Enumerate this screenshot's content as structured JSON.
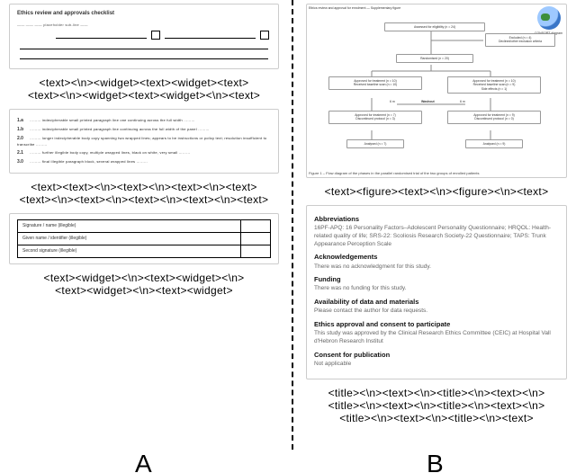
{
  "labels": {
    "colA": "A",
    "colB": "B"
  },
  "a1": {
    "title_line": "Ethics review and approvals checklist",
    "subtitle": "——  ——  ——  placeholder sub-line  ——",
    "field1": "",
    "field2": ""
  },
  "caption_a1": "<text><\\n><widget><text><widget><text>\n<text><\\n><widget><text><widget><\\n><text>",
  "a2": {
    "items": [
      {
        "n": "1.a",
        "t": "……… indecipherable small printed paragraph line one continuing across the full width ………"
      },
      {
        "n": "1.b",
        "t": "……… indecipherable small printed paragraph line continuing across the full width of the panel ………"
      },
      {
        "n": "2.0",
        "t": "……… longer indecipherable body copy spanning two wrapped lines; appears to be instructions or policy text; resolution insufficient to transcribe ………"
      },
      {
        "n": "2.1",
        "t": "……… further illegible body copy, multiple wrapped lines, black on white, very small ………"
      },
      {
        "n": "3.0",
        "t": "……… final illegible paragraph block, several wrapped lines ………"
      }
    ]
  },
  "caption_a2": "<text><text><\\n><text><\\n><text><\\n><text>\n<text><\\n><text><\\n><text><\\n><text><\\n><text>",
  "a3": {
    "rows": [
      [
        "Signature / name (illegible)",
        ""
      ],
      [
        "Given name / identifier (illegible)",
        ""
      ],
      [
        "Second signature (illegible)",
        ""
      ]
    ]
  },
  "caption_a3": "<text><widget><\\n><text><widget><\\n>\n<text><widget><\\n><text><widget>",
  "b1": {
    "corner_left": "Ethics review and approval for enrolment — Supplementary figure",
    "corner_right": "CONSORT diagram",
    "assessed": "Assessed for eligibility (n = 24)",
    "excluded_head": "Excluded (n = 4)",
    "excluded_sub": "Declined/other exclusion criteria",
    "randomised": "Randomised (n = 20)",
    "armL_head": "Approved for treatment (n = 10)",
    "armL_sub": "Received baseline scan (n = 10)",
    "armR_head": "Approved for treatment (n = 10)",
    "armR_sub1": "Received baseline scan (n = 9)",
    "armR_sub2": "Side effects (n = 1)",
    "washout_label": "Washout",
    "t_left": "6 m",
    "t_right": "6 m",
    "armL2_head": "Approved for treatment (n = 7)",
    "armL2_sub": "Discontinued protocol (n = 3)",
    "armR2_head": "Approved for treatment (n = 9)",
    "armR2_sub": "Discontinued protocol (n = 0)",
    "anaL": "Analysed (n = 7)",
    "anaR": "Analysed (n = 9)",
    "figcap": "Figure 1 – Flow diagram of the phases in the parallel randomised trial of the two groups of enrolled patients"
  },
  "caption_b1": "<text><figure><text><\\n><figure><\\n><text>",
  "b2": {
    "abbr_h": "Abbreviations",
    "abbr_p": "16PF-APQ: 16 Personality Factors–Adolescent Personality Questionnaire; HRQOL: Health-related quality of life; SRS-22: Scoliosis Research Society-22 Questionnaire; TAPS: Trunk Appearance Perception Scale",
    "ack_h": "Acknowledgements",
    "ack_p": "There was no acknowledgment for this study.",
    "fund_h": "Funding",
    "fund_p": "There was no funding for this study.",
    "avail_h": "Availability of data and materials",
    "avail_p": "Please contact the author for data requests.",
    "eth_h": "Ethics approval and consent to participate",
    "eth_p": "This study was approved by the Clinical Research Ethics Committee (CEIC) at Hospital Vall d'Hebron Research Institut",
    "cons_h": "Consent for publication",
    "cons_p": "Not applicable"
  },
  "caption_b2": "<title><\\n><text><\\n><title><\\n><text><\\n>\n<title><\\n><text><\\n><title><\\n><text><\\n>\n<title><\\n><text><\\n><title><\\n><text>"
}
